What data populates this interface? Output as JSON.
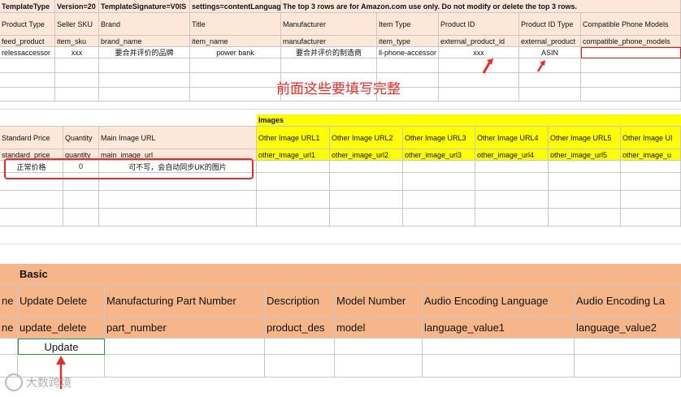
{
  "sheet1": {
    "row_top": [
      "TemplateType",
      "Version=20",
      "TemplateSignature=V0lS",
      "settings=contentLanguage",
      "The top 3 rows are for Amazon.com use only. Do not modify or delete the top 3 rows."
    ],
    "labels": [
      "Product Type",
      "Seller SKU",
      "Brand",
      "Title",
      "Manufacturer",
      "Item Type",
      "Product ID",
      "Product ID Type",
      "Compatible Phone Models"
    ],
    "keys": [
      "feed_product",
      "item_sku",
      "brand_name",
      "item_name",
      "manufacturer",
      "item_type",
      "external_product_id",
      "external_product",
      "compatible_phone_models"
    ],
    "data": [
      "relessaccessor",
      "xxx",
      "要合并评价的品牌",
      "power bank",
      "要合并评价的制造商",
      "ll-phone-accessor",
      "xxx",
      "ASIN",
      ""
    ],
    "annotation": "前面这些要填写完整"
  },
  "sheet2": {
    "group_label": "Images",
    "labels": [
      "Standard Price",
      "Quantity",
      "Main Image URL",
      "Other Image URL1",
      "Other Image URL2",
      "Other Image URL3",
      "Other Image URL4",
      "Other Image URL5",
      "Other Image UI"
    ],
    "keys": [
      "standard_price",
      "quantity",
      "main_image_url",
      "other_image_url1",
      "other_image_url2",
      "other_image_url3",
      "other_image_url4",
      "other_image_url5",
      "other_image_u"
    ],
    "data": [
      "正常价格",
      "0",
      "可不写，会自动同步UK的图片"
    ]
  },
  "sheet3": {
    "group_label": "Basic",
    "labels": [
      "ne",
      "Update Delete",
      "Manufacturing Part Number",
      "Description",
      "Model Number",
      "Audio Encoding Language",
      "Audio Encoding La"
    ],
    "keys": [
      "ne",
      "update_delete",
      "part_number",
      "product_des",
      "model",
      "language_value1",
      "language_value2"
    ],
    "data": [
      "",
      "Update"
    ]
  },
  "watermark": "大数跨境",
  "colors": {
    "header_peach": "#fde7d9",
    "header_orange": "#f6b68a",
    "images_yellow": "#ffff00",
    "annotation_red": "#e0302c",
    "selection_green": "#2f8f3c"
  }
}
